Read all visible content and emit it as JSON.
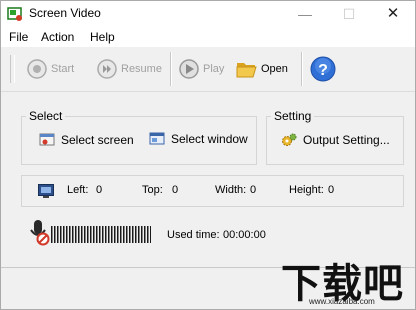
{
  "window": {
    "title": "Screen Video",
    "controls": {
      "minimize": "—",
      "maximize": "☐",
      "close": "✕"
    }
  },
  "menu": {
    "items": [
      "File",
      "Action",
      "Help"
    ]
  },
  "toolbar": {
    "start_label": "Start",
    "resume_label": "Resume",
    "play_label": "Play",
    "open_label": "Open",
    "help_icon": "?"
  },
  "select_group": {
    "title": "Select",
    "select_screen_label": "Select screen",
    "select_window_label": "Select window"
  },
  "setting_group": {
    "title": "Setting",
    "output_setting_label": "Output Setting..."
  },
  "info": {
    "left_label": "Left:",
    "left_value": "0",
    "top_label": "Top:",
    "top_value": "0",
    "width_label": "Width:",
    "width_value": "0",
    "height_label": "Height:",
    "height_value": "0"
  },
  "audio": {
    "used_time_label": "Used time:",
    "used_time_value": "00:00:00"
  },
  "watermark": {
    "big": "下载吧",
    "small": "www.xiazaiba.com"
  },
  "colors": {
    "help_blue": "#2f6fd6",
    "folder_yellow": "#e8b52a",
    "mic_red": "#d23a2a"
  }
}
